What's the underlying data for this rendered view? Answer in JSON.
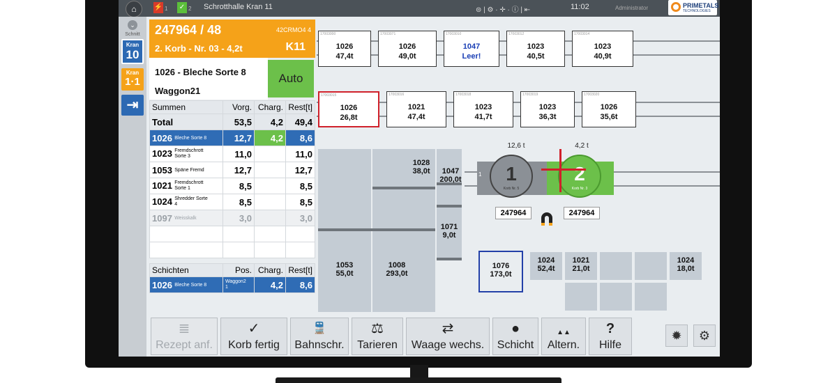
{
  "topbar": {
    "title": "Schrotthalle Kran 11",
    "time": "11:02",
    "user": "Administrator",
    "logo_text": "PRIMETALS",
    "logo_sub": "TECHNOLOGIES",
    "flag1_sub": "1",
    "flag2_sub": "2",
    "icons_text": "⊜ | ⚙ · ✛ · ⓘ | ⇤"
  },
  "rail": {
    "schnitt_label": "Schnitt",
    "kran_label": "Kran",
    "kran_num": "10",
    "kran2_label": "Kran",
    "kran2_num": "1·1"
  },
  "order": {
    "id": "247964 / 48",
    "code": "42CRMO4 4",
    "basket": "2. Korb - Nr. 03 - 4,2t",
    "k": "K11",
    "material": "1026 - Bleche Sorte 8",
    "wagon": "Waggon21",
    "mode": "Auto"
  },
  "summary": {
    "headers": [
      "Summen",
      "Vorg.",
      "Charg.",
      "Rest[t]"
    ],
    "total": {
      "label": "Total",
      "vorg": "53,5",
      "charg": "4,2",
      "rest": "49,4"
    },
    "rows": [
      {
        "code": "1026",
        "name": "Bleche Sorte 8",
        "vorg": "12,7",
        "charg": "4,2",
        "rest": "8,6"
      },
      {
        "code": "1023",
        "name": "Fremdschrott Sorte 3",
        "vorg": "11,0",
        "charg": "",
        "rest": "11,0"
      },
      {
        "code": "1053",
        "name": "Späne Fremd",
        "vorg": "12,7",
        "charg": "",
        "rest": "12,7"
      },
      {
        "code": "1021",
        "name": "Fremdschrott Sorte 1",
        "vorg": "8,5",
        "charg": "",
        "rest": "8,5"
      },
      {
        "code": "1024",
        "name": "Shredder Sorte 4",
        "vorg": "8,5",
        "charg": "",
        "rest": "8,5"
      },
      {
        "code": "1097",
        "name": "Weisskalk",
        "vorg": "3,0",
        "charg": "",
        "rest": "3,0"
      }
    ]
  },
  "shifts": {
    "headers": [
      "Schichten",
      "Pos.",
      "Charg.",
      "Rest[t]"
    ],
    "rows": [
      {
        "code": "1026",
        "name": "Bleche Sorte 8",
        "pos": "Waggon2 1",
        "charg": "4,2",
        "rest": "8,6"
      }
    ]
  },
  "wagons_row1": [
    {
      "code": "1026",
      "value": "47,4t",
      "tag": "17003000"
    },
    {
      "code": "1026",
      "value": "49,0t",
      "tag": "17003071"
    },
    {
      "code": "1047",
      "value": "Leer!",
      "tag": "17003010"
    },
    {
      "code": "1023",
      "value": "40,5t",
      "tag": "17003012"
    },
    {
      "code": "1023",
      "value": "40,9t",
      "tag": "17003014"
    }
  ],
  "wagons_row2": [
    {
      "code": "1026",
      "value": "26,8t",
      "tag": "17003015"
    },
    {
      "code": "1021",
      "value": "47,4t",
      "tag": "17003016"
    },
    {
      "code": "1023",
      "value": "41,7t",
      "tag": "17003018"
    },
    {
      "code": "1023",
      "value": "36,3t",
      "tag": "17003019"
    },
    {
      "code": "1026",
      "value": "35,6t",
      "tag": "17003020"
    }
  ],
  "piles": {
    "p1028": {
      "code": "1028",
      "value": "38,0t"
    },
    "p1047": {
      "code": "1047",
      "value": "200,0t"
    },
    "p1071": {
      "code": "1071",
      "value": "9,0t"
    },
    "p1053": {
      "code": "1053",
      "value": "55,0t"
    },
    "p1008": {
      "code": "1008",
      "value": "293,0t"
    }
  },
  "baskets": {
    "b1_weight": "12,6 t",
    "b2_weight": "4,2 t",
    "b1_num": "1",
    "b2_num": "2",
    "b1_label": "Korb Nr. 5",
    "b2_label": "Korb Nr. 3",
    "track_num": "1",
    "b1_order": "247964",
    "b2_order": "247964",
    "magnet_icon": "magnet-icon"
  },
  "bins": {
    "b1076": {
      "code": "1076",
      "value": "173,0t"
    },
    "b1024a": {
      "code": "1024",
      "value": "52,4t"
    },
    "b1021": {
      "code": "1021",
      "value": "21,0t"
    },
    "b1024b": {
      "code": "1024",
      "value": "18,0t"
    }
  },
  "toolbar": [
    {
      "label": "Rezept anf.",
      "icon": "≣"
    },
    {
      "label": "Korb fertig",
      "icon": "✓"
    },
    {
      "label": "Bahnschr.",
      "icon": "🚆"
    },
    {
      "label": "Tarieren",
      "icon": "⚖"
    },
    {
      "label": "Waage wechs.",
      "icon": "⇄"
    },
    {
      "label": "Schicht",
      "icon": "●"
    },
    {
      "label": "Altern.",
      "icon": "▲▲"
    },
    {
      "label": "Hilfe",
      "icon": "?"
    }
  ],
  "colors": {
    "orange": "#f5a219",
    "green": "#6cc04a",
    "blue": "#2f6cb5",
    "red": "#d0202a"
  }
}
